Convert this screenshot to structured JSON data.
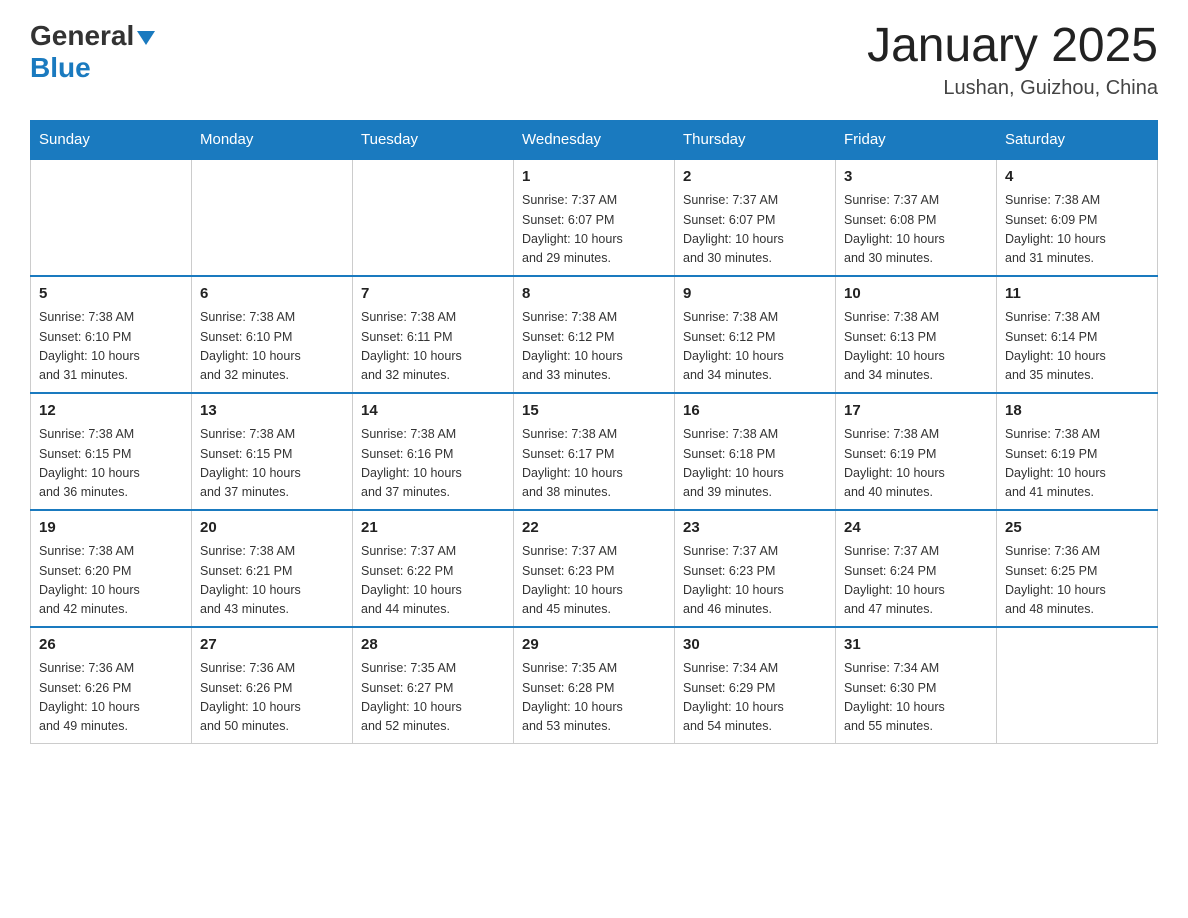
{
  "header": {
    "logo": {
      "general": "General",
      "blue": "Blue",
      "arrow": "▼"
    },
    "title": "January 2025",
    "location": "Lushan, Guizhou, China"
  },
  "days_of_week": [
    "Sunday",
    "Monday",
    "Tuesday",
    "Wednesday",
    "Thursday",
    "Friday",
    "Saturday"
  ],
  "weeks": [
    [
      {
        "day": "",
        "info": ""
      },
      {
        "day": "",
        "info": ""
      },
      {
        "day": "",
        "info": ""
      },
      {
        "day": "1",
        "info": "Sunrise: 7:37 AM\nSunset: 6:07 PM\nDaylight: 10 hours\nand 29 minutes."
      },
      {
        "day": "2",
        "info": "Sunrise: 7:37 AM\nSunset: 6:07 PM\nDaylight: 10 hours\nand 30 minutes."
      },
      {
        "day": "3",
        "info": "Sunrise: 7:37 AM\nSunset: 6:08 PM\nDaylight: 10 hours\nand 30 minutes."
      },
      {
        "day": "4",
        "info": "Sunrise: 7:38 AM\nSunset: 6:09 PM\nDaylight: 10 hours\nand 31 minutes."
      }
    ],
    [
      {
        "day": "5",
        "info": "Sunrise: 7:38 AM\nSunset: 6:10 PM\nDaylight: 10 hours\nand 31 minutes."
      },
      {
        "day": "6",
        "info": "Sunrise: 7:38 AM\nSunset: 6:10 PM\nDaylight: 10 hours\nand 32 minutes."
      },
      {
        "day": "7",
        "info": "Sunrise: 7:38 AM\nSunset: 6:11 PM\nDaylight: 10 hours\nand 32 minutes."
      },
      {
        "day": "8",
        "info": "Sunrise: 7:38 AM\nSunset: 6:12 PM\nDaylight: 10 hours\nand 33 minutes."
      },
      {
        "day": "9",
        "info": "Sunrise: 7:38 AM\nSunset: 6:12 PM\nDaylight: 10 hours\nand 34 minutes."
      },
      {
        "day": "10",
        "info": "Sunrise: 7:38 AM\nSunset: 6:13 PM\nDaylight: 10 hours\nand 34 minutes."
      },
      {
        "day": "11",
        "info": "Sunrise: 7:38 AM\nSunset: 6:14 PM\nDaylight: 10 hours\nand 35 minutes."
      }
    ],
    [
      {
        "day": "12",
        "info": "Sunrise: 7:38 AM\nSunset: 6:15 PM\nDaylight: 10 hours\nand 36 minutes."
      },
      {
        "day": "13",
        "info": "Sunrise: 7:38 AM\nSunset: 6:15 PM\nDaylight: 10 hours\nand 37 minutes."
      },
      {
        "day": "14",
        "info": "Sunrise: 7:38 AM\nSunset: 6:16 PM\nDaylight: 10 hours\nand 37 minutes."
      },
      {
        "day": "15",
        "info": "Sunrise: 7:38 AM\nSunset: 6:17 PM\nDaylight: 10 hours\nand 38 minutes."
      },
      {
        "day": "16",
        "info": "Sunrise: 7:38 AM\nSunset: 6:18 PM\nDaylight: 10 hours\nand 39 minutes."
      },
      {
        "day": "17",
        "info": "Sunrise: 7:38 AM\nSunset: 6:19 PM\nDaylight: 10 hours\nand 40 minutes."
      },
      {
        "day": "18",
        "info": "Sunrise: 7:38 AM\nSunset: 6:19 PM\nDaylight: 10 hours\nand 41 minutes."
      }
    ],
    [
      {
        "day": "19",
        "info": "Sunrise: 7:38 AM\nSunset: 6:20 PM\nDaylight: 10 hours\nand 42 minutes."
      },
      {
        "day": "20",
        "info": "Sunrise: 7:38 AM\nSunset: 6:21 PM\nDaylight: 10 hours\nand 43 minutes."
      },
      {
        "day": "21",
        "info": "Sunrise: 7:37 AM\nSunset: 6:22 PM\nDaylight: 10 hours\nand 44 minutes."
      },
      {
        "day": "22",
        "info": "Sunrise: 7:37 AM\nSunset: 6:23 PM\nDaylight: 10 hours\nand 45 minutes."
      },
      {
        "day": "23",
        "info": "Sunrise: 7:37 AM\nSunset: 6:23 PM\nDaylight: 10 hours\nand 46 minutes."
      },
      {
        "day": "24",
        "info": "Sunrise: 7:37 AM\nSunset: 6:24 PM\nDaylight: 10 hours\nand 47 minutes."
      },
      {
        "day": "25",
        "info": "Sunrise: 7:36 AM\nSunset: 6:25 PM\nDaylight: 10 hours\nand 48 minutes."
      }
    ],
    [
      {
        "day": "26",
        "info": "Sunrise: 7:36 AM\nSunset: 6:26 PM\nDaylight: 10 hours\nand 49 minutes."
      },
      {
        "day": "27",
        "info": "Sunrise: 7:36 AM\nSunset: 6:26 PM\nDaylight: 10 hours\nand 50 minutes."
      },
      {
        "day": "28",
        "info": "Sunrise: 7:35 AM\nSunset: 6:27 PM\nDaylight: 10 hours\nand 52 minutes."
      },
      {
        "day": "29",
        "info": "Sunrise: 7:35 AM\nSunset: 6:28 PM\nDaylight: 10 hours\nand 53 minutes."
      },
      {
        "day": "30",
        "info": "Sunrise: 7:34 AM\nSunset: 6:29 PM\nDaylight: 10 hours\nand 54 minutes."
      },
      {
        "day": "31",
        "info": "Sunrise: 7:34 AM\nSunset: 6:30 PM\nDaylight: 10 hours\nand 55 minutes."
      },
      {
        "day": "",
        "info": ""
      }
    ]
  ]
}
